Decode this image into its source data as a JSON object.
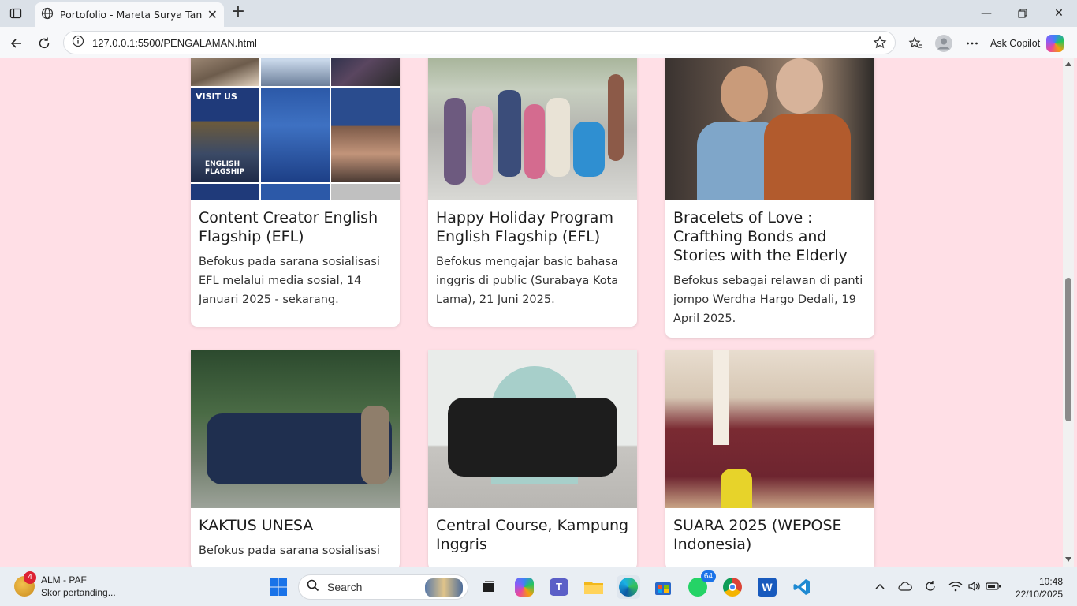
{
  "browser": {
    "tab_title": "Portofolio - Mareta Surya Tananja",
    "url": "127.0.0.1:5500/PENGALAMAN.html",
    "copilot_label": "Ask Copilot"
  },
  "cards": [
    {
      "title": "Content Creator English Flagship (EFL)",
      "description": "Befokus pada sarana sosialisasi EFL melalui media sosial, 14 Januari 2025 - sekarang."
    },
    {
      "title": "Happy Holiday Program English Flagship (EFL)",
      "description": "Befokus mengajar basic bahasa inggris di public (Surabaya Kota Lama), 21 Juni 2025."
    },
    {
      "title": "Bracelets of Love : Crafthing Bonds and Stories with the Elderly",
      "description": "Befokus sebagai relawan di panti jompo Werdha Hargo Dedali, 19 April 2025."
    },
    {
      "title": "KAKTUS UNESA",
      "description": "Befokus pada sarana sosialisasi"
    },
    {
      "title": "Central Course, Kampung Inggris",
      "description": ""
    },
    {
      "title": "SUARA 2025 (WEPOSE Indonesia)",
      "description": ""
    }
  ],
  "collage_captions": {
    "english_flagship": "ENGLISH FLAGSHIP",
    "visit_us": "VISIT US"
  },
  "taskbar": {
    "weather_title": "ALM - PAF",
    "weather_subtitle": "Skor pertanding...",
    "weather_badge": "4",
    "search_label": "Search",
    "whatsapp_badge": "64",
    "time": "10:48",
    "date": "22/10/2025"
  },
  "icons": [
    "tab-menu-icon",
    "globe-icon",
    "close-icon",
    "plus-icon",
    "minimize-icon",
    "maximize-icon",
    "back-icon",
    "reload-icon",
    "info-icon",
    "star-icon",
    "favorites-icon",
    "profile-icon",
    "more-icon",
    "copilot-icon",
    "search-icon",
    "windows-start-icon"
  ]
}
